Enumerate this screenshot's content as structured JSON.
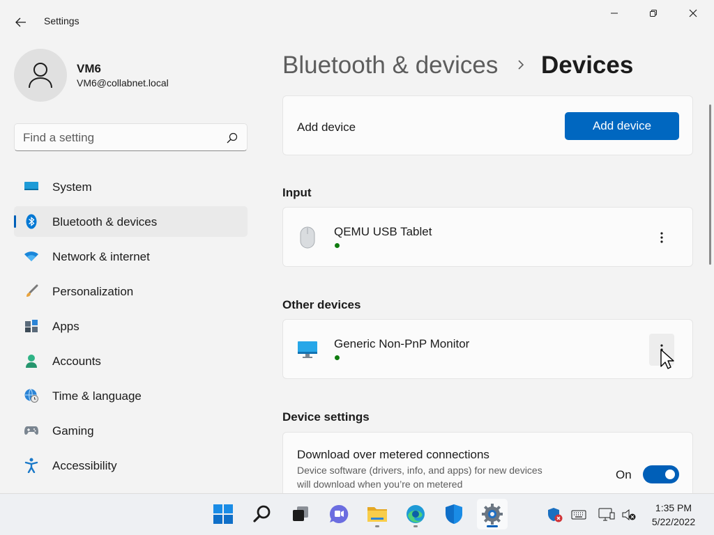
{
  "titlebar": {
    "app_title": "Settings",
    "icons": {
      "back": "arrow-left-icon",
      "minimize": "minimize-icon",
      "maximize": "restore-icon",
      "close": "close-icon"
    }
  },
  "profile": {
    "name": "VM6",
    "email": "VM6@collabnet.local",
    "avatar_icon": "user-silhouette-icon"
  },
  "search": {
    "placeholder": "Find a setting",
    "value": "",
    "icon": "search-icon"
  },
  "nav": {
    "selected": "Bluetooth & devices",
    "items": [
      {
        "label": "System",
        "icon": "monitor-icon"
      },
      {
        "label": "Bluetooth & devices",
        "icon": "bluetooth-icon"
      },
      {
        "label": "Network & internet",
        "icon": "wifi-icon"
      },
      {
        "label": "Personalization",
        "icon": "brush-icon"
      },
      {
        "label": "Apps",
        "icon": "apps-grid-icon"
      },
      {
        "label": "Accounts",
        "icon": "person-icon"
      },
      {
        "label": "Time & language",
        "icon": "globe-clock-icon"
      },
      {
        "label": "Gaming",
        "icon": "gamepad-icon"
      },
      {
        "label": "Accessibility",
        "icon": "accessibility-icon"
      }
    ]
  },
  "breadcrumb": {
    "parent": "Bluetooth & devices",
    "separator_icon": "chevron-right-icon",
    "current": "Devices"
  },
  "add_device": {
    "label": "Add device",
    "button": "Add device"
  },
  "sections": {
    "input": "Input",
    "other": "Other devices",
    "settings": "Device settings"
  },
  "devices": {
    "input": [
      {
        "name": "QEMU USB Tablet",
        "icon": "mouse-icon",
        "status_color": "#107c10"
      }
    ],
    "other": [
      {
        "name": "Generic Non-PnP Monitor",
        "icon": "monitor-icon",
        "status_color": "#107c10"
      }
    ]
  },
  "device_settings": {
    "metered": {
      "title": "Download over metered connections",
      "description": "Device software (drivers, info, and apps) for new devices will download when you’re on metered",
      "state": "On",
      "enabled": true
    }
  },
  "taskbar": {
    "apps": [
      {
        "name": "Start",
        "icon": "windows-logo-icon",
        "running": false
      },
      {
        "name": "Search",
        "icon": "search-icon",
        "running": false
      },
      {
        "name": "Task View",
        "icon": "task-view-icon",
        "running": false
      },
      {
        "name": "Chat",
        "icon": "chat-icon",
        "running": false
      },
      {
        "name": "File Explorer",
        "icon": "folder-icon",
        "running": true
      },
      {
        "name": "Microsoft Edge",
        "icon": "edge-icon",
        "running": true
      },
      {
        "name": "Microsoft Store",
        "icon": "shield-icon",
        "running": false
      },
      {
        "name": "Settings",
        "icon": "gear-icon",
        "running": true,
        "active": true
      }
    ],
    "tray": [
      "security-shield-alert-icon",
      "keyboard-icon",
      "network-icon",
      "volume-muted-icon"
    ],
    "time": "1:35 PM",
    "date": "5/22/2022"
  },
  "colors": {
    "accent": "#005fb8",
    "button": "#0067c0",
    "status_connected": "#107c10",
    "background": "#f3f3f3"
  }
}
